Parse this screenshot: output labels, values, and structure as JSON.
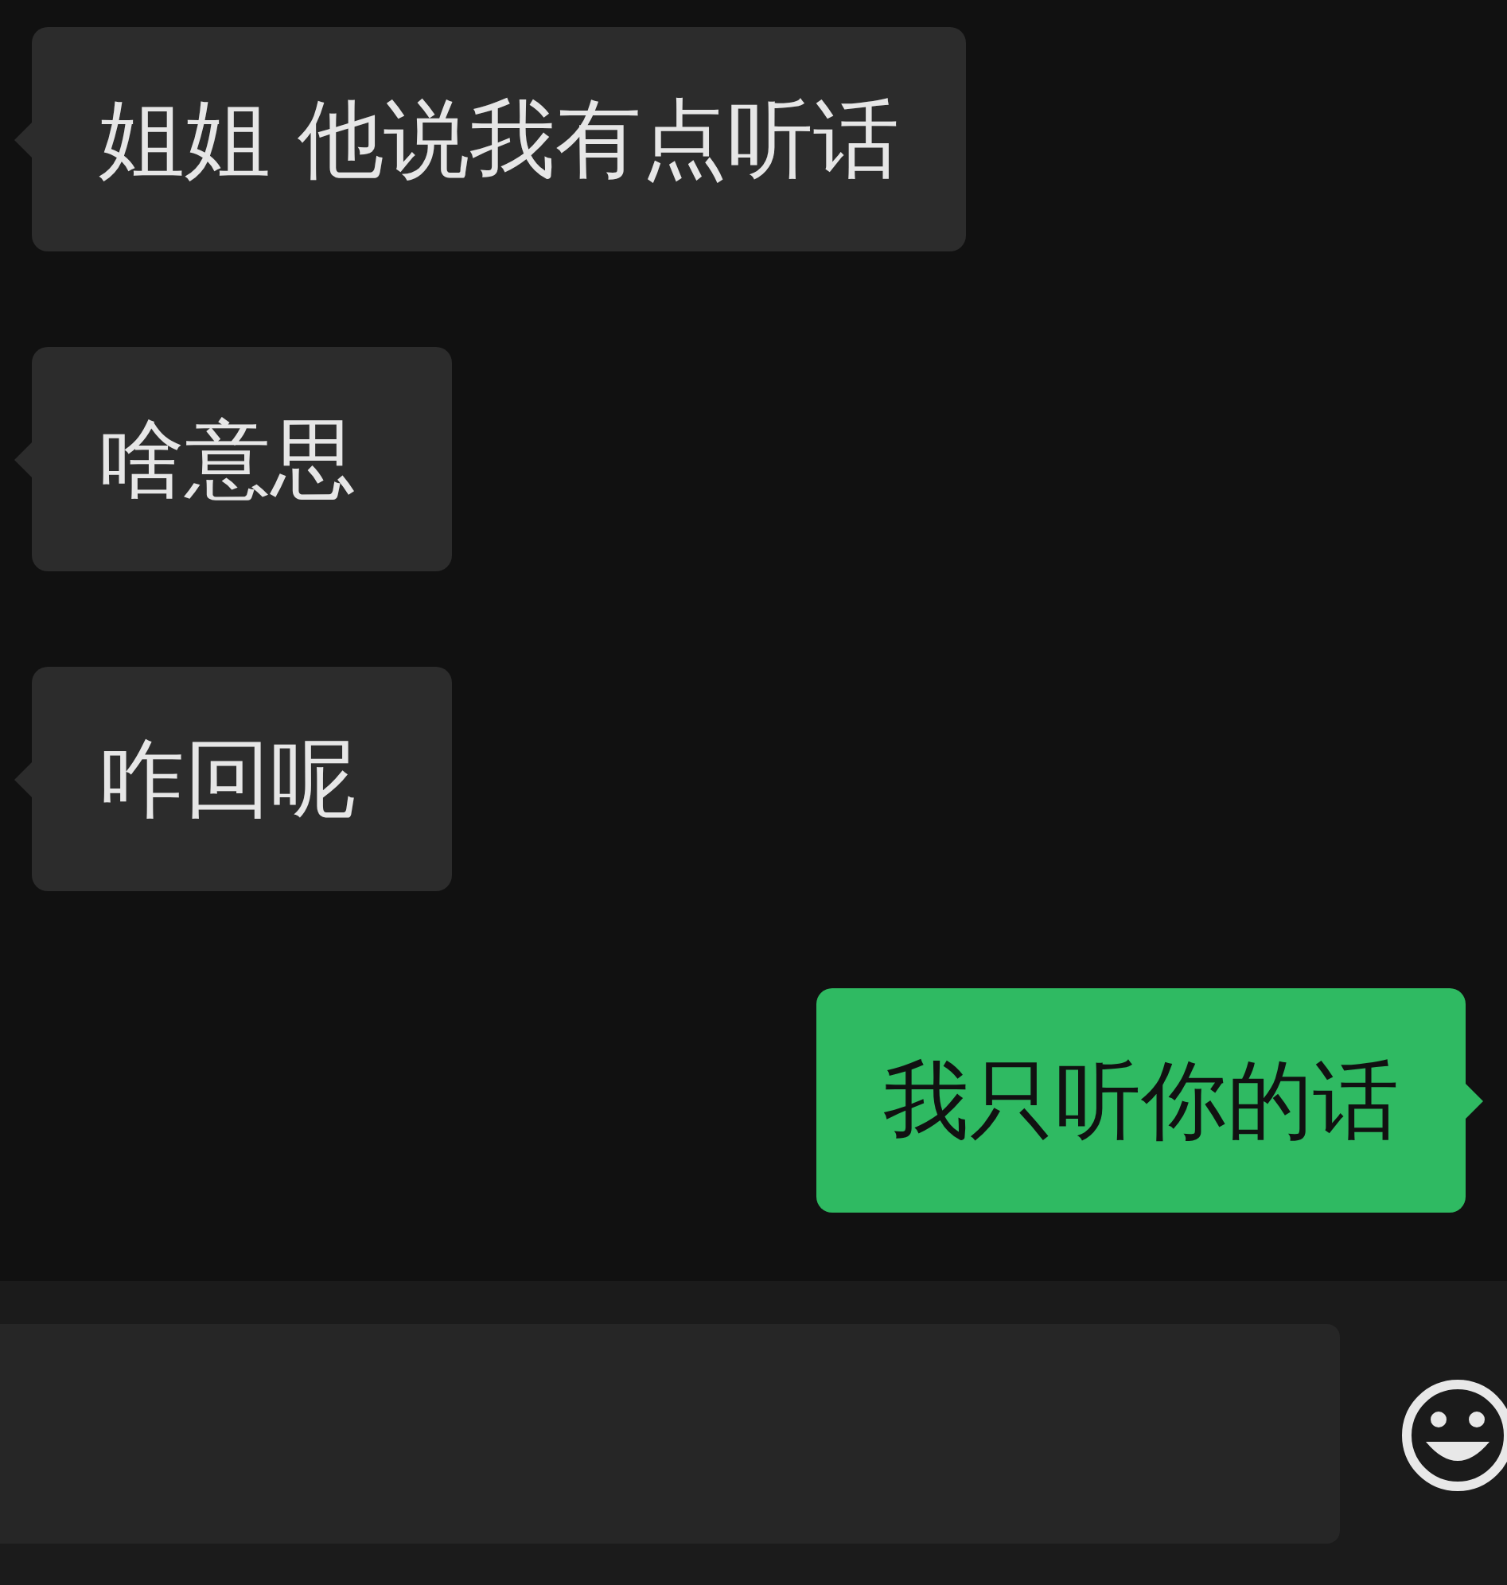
{
  "messages": [
    {
      "kind": "received",
      "text": "姐姐 他说我有点听话"
    },
    {
      "kind": "received",
      "text": "啥意思"
    },
    {
      "kind": "received",
      "text": "咋回呢"
    },
    {
      "kind": "sent",
      "text": "我只听你的话"
    }
  ]
}
